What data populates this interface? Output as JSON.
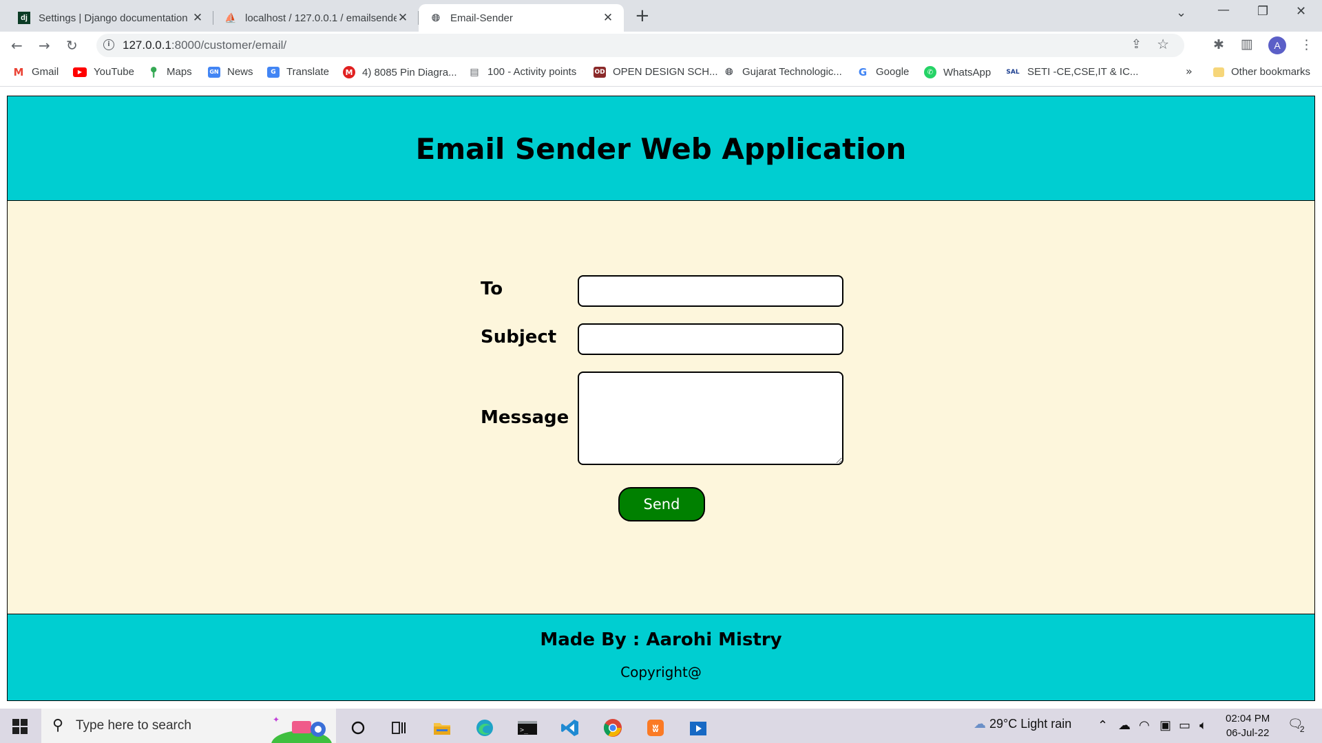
{
  "browser": {
    "tabs": [
      {
        "title": "Settings | Django documentation",
        "icon": "django-icon"
      },
      {
        "title": "localhost / 127.0.0.1 / emailsender",
        "icon": "phpmyadmin-icon"
      },
      {
        "title": "Email-Sender",
        "icon": "globe-icon"
      }
    ],
    "url_host": "127.0.0.1",
    "url_path": ":8000/customer/email/",
    "avatar_letter": "A",
    "bookmarks": [
      {
        "label": "Gmail",
        "icon": "gmail-icon"
      },
      {
        "label": "YouTube",
        "icon": "youtube-icon"
      },
      {
        "label": "Maps",
        "icon": "maps-icon"
      },
      {
        "label": "News",
        "icon": "news-icon"
      },
      {
        "label": "Translate",
        "icon": "translate-icon"
      },
      {
        "label": "4) 8085 Pin Diagra...",
        "icon": "m-icon"
      },
      {
        "label": "100 - Activity points",
        "icon": "doc-icon"
      },
      {
        "label": "OPEN DESIGN SCH...",
        "icon": "school-icon"
      },
      {
        "label": "Gujarat Technologic...",
        "icon": "globe-icon"
      },
      {
        "label": "Google",
        "icon": "google-icon"
      },
      {
        "label": "WhatsApp",
        "icon": "whatsapp-icon"
      },
      {
        "label": "SETI -CE,CSE,IT & IC...",
        "icon": "sal-icon"
      }
    ],
    "bookmarks_more": "»",
    "other_bookmarks": "Other bookmarks"
  },
  "page": {
    "heading": "Email Sender Web Application",
    "form": {
      "to_label": "To",
      "subject_label": "Subject",
      "message_label": "Message",
      "to_value": "",
      "subject_value": "",
      "message_value": "",
      "send_label": "Send"
    },
    "footer": {
      "made_by": "Made By : Aarohi Mistry",
      "copyright": "Copyright@"
    }
  },
  "taskbar": {
    "search_placeholder": "Type here to search",
    "weather": "29°C  Light rain",
    "time": "02:04 PM",
    "date": "06-Jul-22",
    "notification_count": "2"
  },
  "colors": {
    "header_bg": "#00ced1",
    "main_bg": "#fdf6dc",
    "send_button": "#008000"
  }
}
